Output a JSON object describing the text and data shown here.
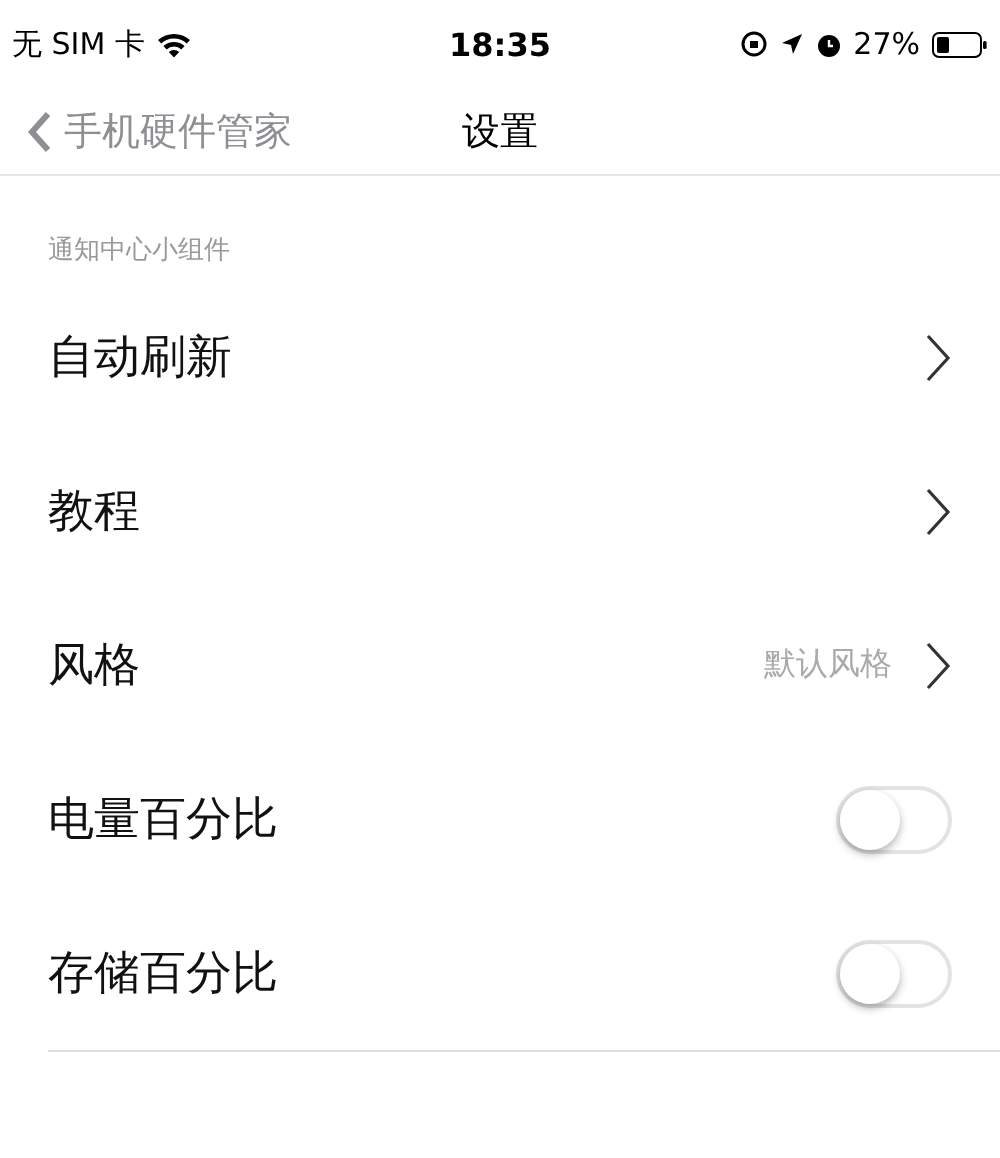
{
  "status_bar": {
    "carrier": "无 SIM 卡",
    "time": "18:35",
    "battery": "27%"
  },
  "nav": {
    "back": "手机硬件管家",
    "title": "设置"
  },
  "section": {
    "header": "通知中心小组件",
    "rows": [
      {
        "kind": "link",
        "label": "自动刷新"
      },
      {
        "kind": "link",
        "label": "教程"
      },
      {
        "kind": "link",
        "label": "风格",
        "value": "默认风格"
      },
      {
        "kind": "switch",
        "label": "电量百分比",
        "on": false
      },
      {
        "kind": "switch",
        "label": "存储百分比",
        "on": false
      }
    ]
  }
}
